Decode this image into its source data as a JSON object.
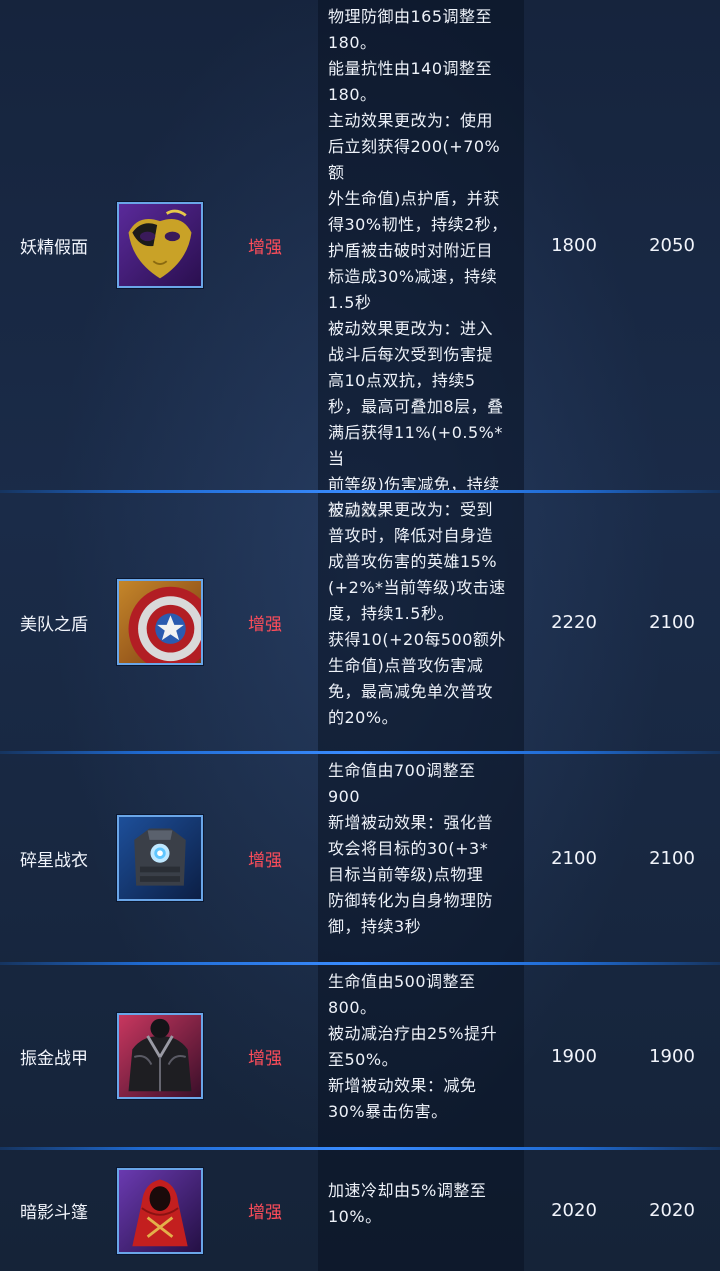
{
  "rows": [
    {
      "name": "妖精假面",
      "type": "增强",
      "desc": "物理防御由165调整至\n180。\n能量抗性由140调整至\n180。\n主动效果更改为：使用\n后立刻获得200(+70%额\n外生命值)点护盾，并获\n得30%韧性，持续2秒，\n护盾被击破时对附近目\n标造成30%减速，持续\n1.5秒\n被动效果更改为：进入\n战斗后每次受到伤害提\n高10点双抗，持续5\n秒，最高可叠加8层，叠\n满后获得11%(+0.5%*当\n前等级)伤害减免，持续\n至脱战。",
      "old_value": "1800",
      "new_value": "2050",
      "icon": "mask-icon"
    },
    {
      "name": "美队之盾",
      "type": "增强",
      "desc": "被动效果更改为：受到\n普攻时，降低对自身造\n成普攻伤害的英雄15%\n(+2%*当前等级)攻击速\n度，持续1.5秒。\n获得10(+20每500额外\n生命值)点普攻伤害减\n免，最高减免单次普攻\n的20%。",
      "old_value": "2220",
      "new_value": "2100",
      "icon": "shield-icon"
    },
    {
      "name": "碎星战衣",
      "type": "增强",
      "desc": "生命值由700调整至\n900\n新增被动效果：强化普\n攻会将目标的30(+3*\n目标当前等级)点物理\n防御转化为自身物理防\n御，持续3秒",
      "old_value": "2100",
      "new_value": "2100",
      "icon": "armor-suit-icon"
    },
    {
      "name": "振金战甲",
      "type": "增强",
      "desc": "生命值由500调整至\n800。\n被动减治疗由25%提升\n至50%。\n新增被动效果：减免\n30%暴击伤害。",
      "old_value": "1900",
      "new_value": "1900",
      "icon": "black-armor-icon"
    },
    {
      "name": "暗影斗篷",
      "type": "增强",
      "desc": "加速冷却由5%调整至\n10%。",
      "old_value": "2020",
      "new_value": "2020",
      "icon": "red-cloak-icon"
    }
  ]
}
